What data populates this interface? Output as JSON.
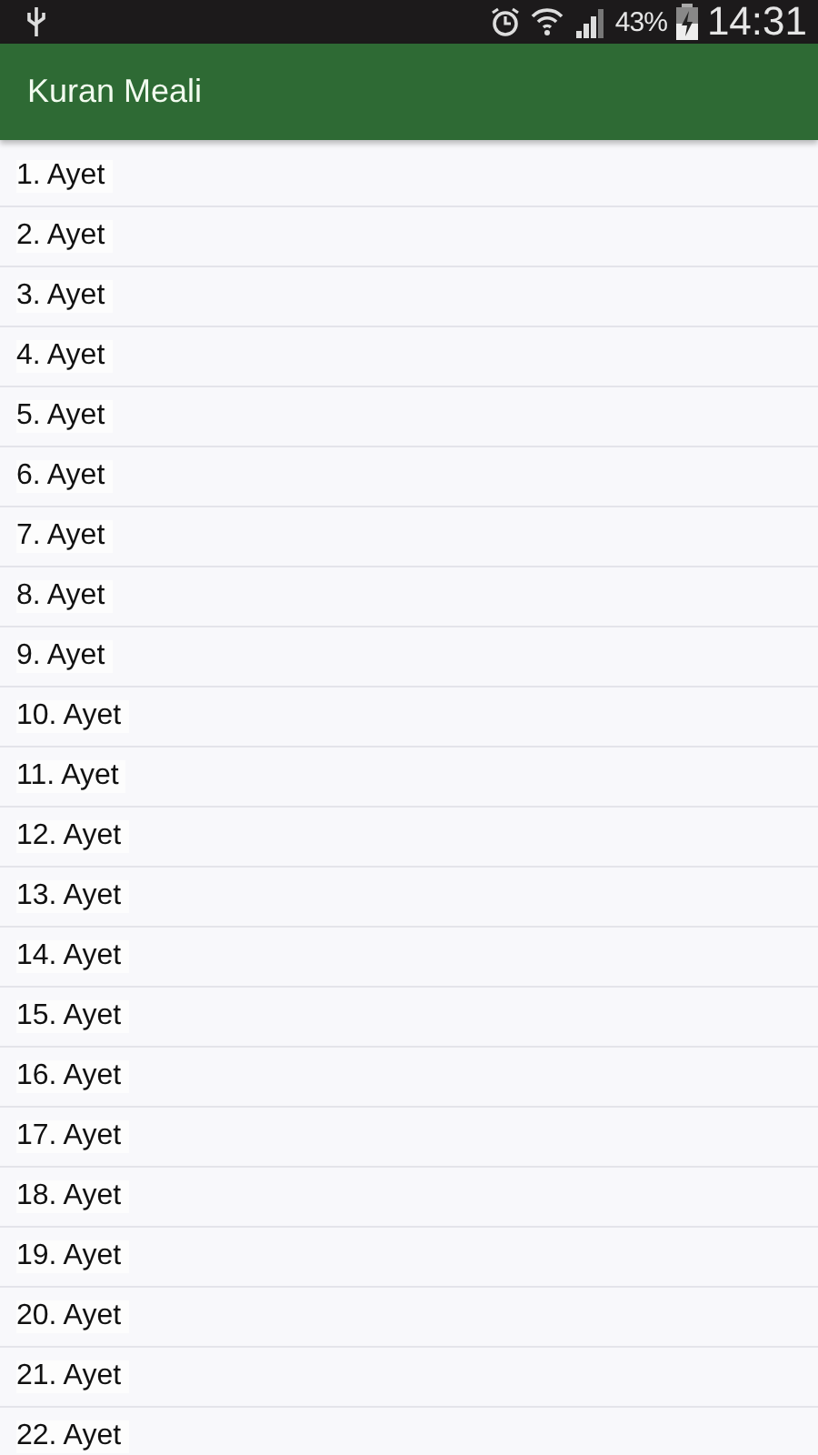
{
  "status_bar": {
    "battery": "43%",
    "time": "14:31"
  },
  "app_bar": {
    "title": "Kuran Meali"
  },
  "verses": [
    {
      "label": "1. Ayet"
    },
    {
      "label": "2. Ayet"
    },
    {
      "label": "3. Ayet"
    },
    {
      "label": "4. Ayet"
    },
    {
      "label": "5. Ayet"
    },
    {
      "label": "6. Ayet"
    },
    {
      "label": "7. Ayet"
    },
    {
      "label": "8. Ayet"
    },
    {
      "label": "9. Ayet"
    },
    {
      "label": "10. Ayet"
    },
    {
      "label": "11. Ayet"
    },
    {
      "label": "12. Ayet"
    },
    {
      "label": "13. Ayet"
    },
    {
      "label": "14. Ayet"
    },
    {
      "label": "15. Ayet"
    },
    {
      "label": "16. Ayet"
    },
    {
      "label": "17. Ayet"
    },
    {
      "label": "18. Ayet"
    },
    {
      "label": "19. Ayet"
    },
    {
      "label": "20. Ayet"
    },
    {
      "label": "21. Ayet"
    },
    {
      "label": "22. Ayet"
    }
  ]
}
